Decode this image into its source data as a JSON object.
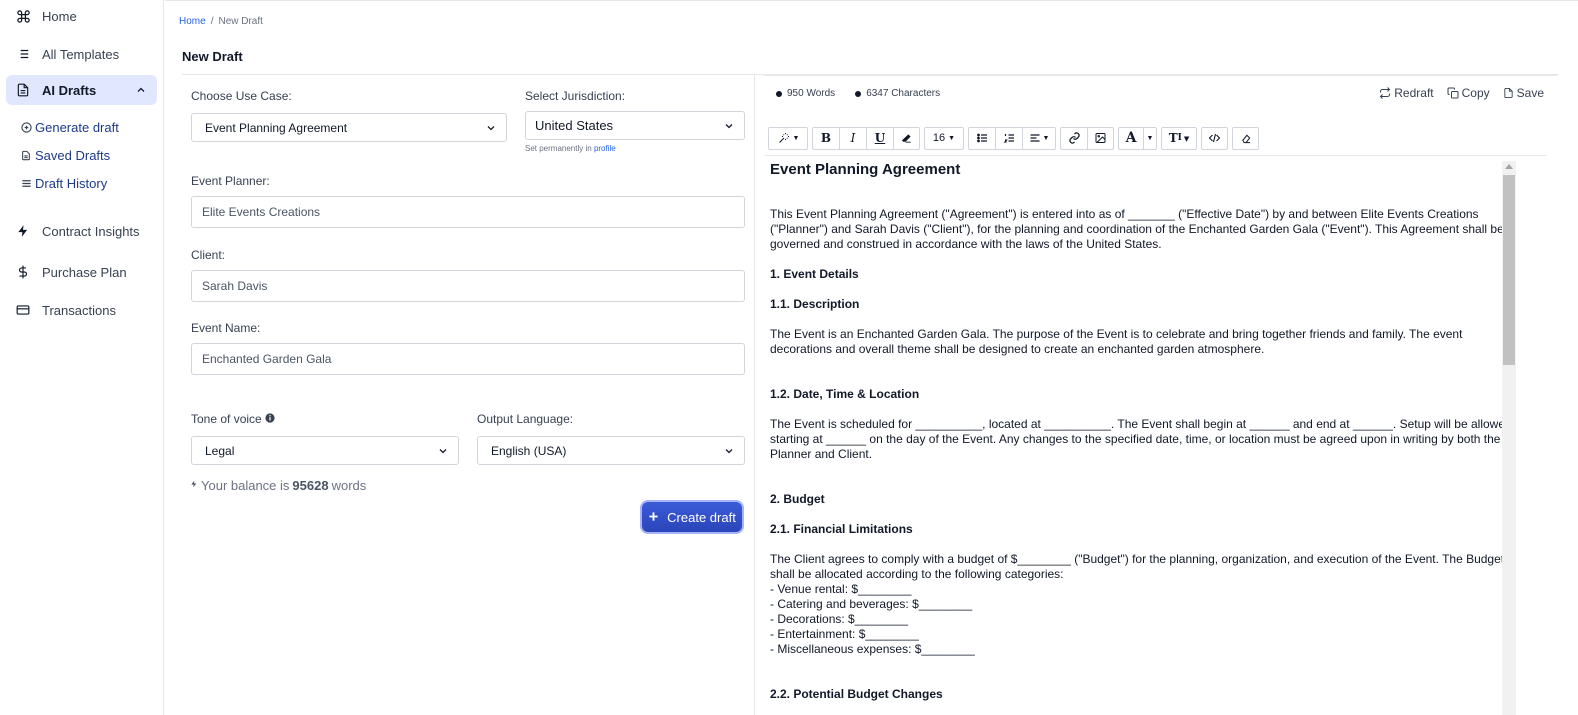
{
  "sidebar": {
    "items": [
      {
        "label": "Home",
        "icon": "command-icon"
      },
      {
        "label": "All Templates",
        "icon": "list-icon"
      },
      {
        "label": "AI Drafts",
        "icon": "document-icon"
      },
      {
        "label": "Contract Insights",
        "icon": "bolt-icon"
      },
      {
        "label": "Purchase Plan",
        "icon": "dollar-icon"
      },
      {
        "label": "Transactions",
        "icon": "credit-card-icon"
      }
    ],
    "subitems": [
      {
        "label": "Generate draft",
        "icon": "plus-circle-icon"
      },
      {
        "label": "Saved Drafts",
        "icon": "file-icon"
      },
      {
        "label": "Draft History",
        "icon": "menu-icon"
      }
    ]
  },
  "breadcrumb": {
    "home": "Home",
    "separator": "/",
    "current": "New Draft"
  },
  "page_title": "New Draft",
  "form": {
    "use_case_label": "Choose Use Case:",
    "use_case_value": "Event Planning Agreement",
    "jurisdiction_label": "Select Jurisdiction:",
    "jurisdiction_value": "United States",
    "jurisdiction_hint": "Set permanently in",
    "jurisdiction_hint_link": "profile",
    "planner_label": "Event Planner:",
    "planner_value": "Elite Events Creations",
    "client_label": "Client:",
    "client_value": "Sarah Davis",
    "event_name_label": "Event Name:",
    "event_name_value": "Enchanted Garden Gala",
    "tone_label": "Tone of voice",
    "tone_value": "Legal",
    "language_label": "Output Language:",
    "language_value": "English (USA)",
    "balance_prefix": "Your balance is",
    "balance_value": "95628",
    "balance_suffix": "words",
    "create_label": "Create draft"
  },
  "editor": {
    "words": "950 Words",
    "characters": "6347 Characters",
    "redraft": "Redraft",
    "copy": "Copy",
    "save": "Save",
    "font_size": "16"
  },
  "document": {
    "title": "Event Planning Agreement",
    "intro": "This Event Planning Agreement (\"Agreement\") is entered into as of _______ (\"Effective Date\") by and between Elite Events Creations (\"Planner\") and Sarah Davis (\"Client\"), for the planning and coordination of the Enchanted Garden Gala (\"Event\"). This Agreement shall be governed and construed in accordance with the laws of the United States.",
    "s1": "1. Event Details",
    "s11": "1.1. Description",
    "s11_text": "The Event is an Enchanted Garden Gala. The purpose of the Event is to celebrate and bring together friends and family. The event decorations and overall theme shall be designed to create an enchanted garden atmosphere.",
    "s12": "1.2. Date, Time & Location",
    "s12_text": "The Event is scheduled for __________, located at __________. The Event shall begin at ______ and end at ______. Setup will be allowed starting at ______ on the day of the Event. Any changes to the specified date, time, or location must be agreed upon in writing by both the Planner and Client.",
    "s2": "2. Budget",
    "s21": "2.1. Financial Limitations",
    "s21_text": "The Client agrees to comply with a budget of $________ (\"Budget\") for the planning, organization, and execution of the Event. The Budget shall be allocated according to the following categories:",
    "budget_items": [
      "- Venue rental: $________",
      "- Catering and beverages: $________",
      "- Decorations: $________",
      "- Entertainment: $________",
      "- Miscellaneous expenses: $________"
    ],
    "s22": "2.2. Potential Budget Changes"
  }
}
